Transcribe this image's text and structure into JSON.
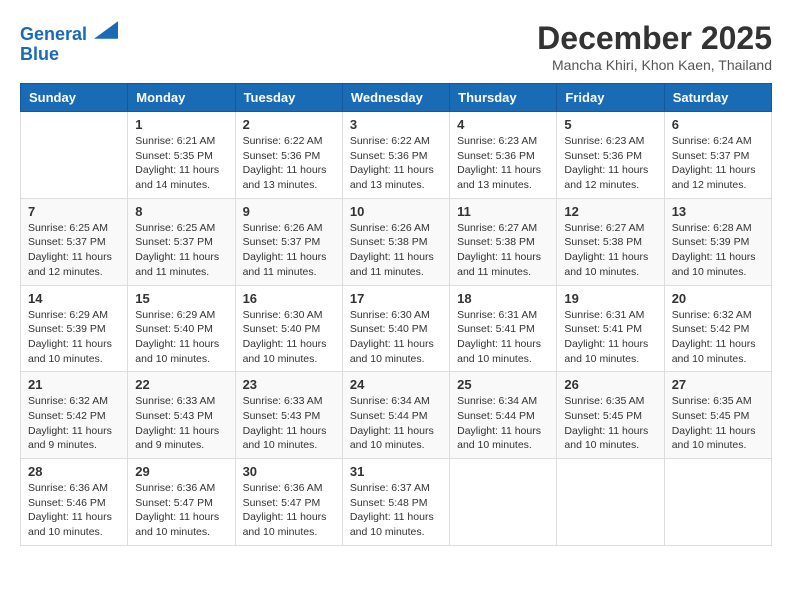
{
  "header": {
    "logo_line1": "General",
    "logo_line2": "Blue",
    "month_title": "December 2025",
    "location": "Mancha Khiri, Khon Kaen, Thailand"
  },
  "days_of_week": [
    "Sunday",
    "Monday",
    "Tuesday",
    "Wednesday",
    "Thursday",
    "Friday",
    "Saturday"
  ],
  "weeks": [
    [
      {
        "day": "",
        "info": ""
      },
      {
        "day": "1",
        "info": "Sunrise: 6:21 AM\nSunset: 5:35 PM\nDaylight: 11 hours\nand 14 minutes."
      },
      {
        "day": "2",
        "info": "Sunrise: 6:22 AM\nSunset: 5:36 PM\nDaylight: 11 hours\nand 13 minutes."
      },
      {
        "day": "3",
        "info": "Sunrise: 6:22 AM\nSunset: 5:36 PM\nDaylight: 11 hours\nand 13 minutes."
      },
      {
        "day": "4",
        "info": "Sunrise: 6:23 AM\nSunset: 5:36 PM\nDaylight: 11 hours\nand 13 minutes."
      },
      {
        "day": "5",
        "info": "Sunrise: 6:23 AM\nSunset: 5:36 PM\nDaylight: 11 hours\nand 12 minutes."
      },
      {
        "day": "6",
        "info": "Sunrise: 6:24 AM\nSunset: 5:37 PM\nDaylight: 11 hours\nand 12 minutes."
      }
    ],
    [
      {
        "day": "7",
        "info": "Sunrise: 6:25 AM\nSunset: 5:37 PM\nDaylight: 11 hours\nand 12 minutes."
      },
      {
        "day": "8",
        "info": "Sunrise: 6:25 AM\nSunset: 5:37 PM\nDaylight: 11 hours\nand 11 minutes."
      },
      {
        "day": "9",
        "info": "Sunrise: 6:26 AM\nSunset: 5:37 PM\nDaylight: 11 hours\nand 11 minutes."
      },
      {
        "day": "10",
        "info": "Sunrise: 6:26 AM\nSunset: 5:38 PM\nDaylight: 11 hours\nand 11 minutes."
      },
      {
        "day": "11",
        "info": "Sunrise: 6:27 AM\nSunset: 5:38 PM\nDaylight: 11 hours\nand 11 minutes."
      },
      {
        "day": "12",
        "info": "Sunrise: 6:27 AM\nSunset: 5:38 PM\nDaylight: 11 hours\nand 10 minutes."
      },
      {
        "day": "13",
        "info": "Sunrise: 6:28 AM\nSunset: 5:39 PM\nDaylight: 11 hours\nand 10 minutes."
      }
    ],
    [
      {
        "day": "14",
        "info": "Sunrise: 6:29 AM\nSunset: 5:39 PM\nDaylight: 11 hours\nand 10 minutes."
      },
      {
        "day": "15",
        "info": "Sunrise: 6:29 AM\nSunset: 5:40 PM\nDaylight: 11 hours\nand 10 minutes."
      },
      {
        "day": "16",
        "info": "Sunrise: 6:30 AM\nSunset: 5:40 PM\nDaylight: 11 hours\nand 10 minutes."
      },
      {
        "day": "17",
        "info": "Sunrise: 6:30 AM\nSunset: 5:40 PM\nDaylight: 11 hours\nand 10 minutes."
      },
      {
        "day": "18",
        "info": "Sunrise: 6:31 AM\nSunset: 5:41 PM\nDaylight: 11 hours\nand 10 minutes."
      },
      {
        "day": "19",
        "info": "Sunrise: 6:31 AM\nSunset: 5:41 PM\nDaylight: 11 hours\nand 10 minutes."
      },
      {
        "day": "20",
        "info": "Sunrise: 6:32 AM\nSunset: 5:42 PM\nDaylight: 11 hours\nand 10 minutes."
      }
    ],
    [
      {
        "day": "21",
        "info": "Sunrise: 6:32 AM\nSunset: 5:42 PM\nDaylight: 11 hours\nand 9 minutes."
      },
      {
        "day": "22",
        "info": "Sunrise: 6:33 AM\nSunset: 5:43 PM\nDaylight: 11 hours\nand 9 minutes."
      },
      {
        "day": "23",
        "info": "Sunrise: 6:33 AM\nSunset: 5:43 PM\nDaylight: 11 hours\nand 10 minutes."
      },
      {
        "day": "24",
        "info": "Sunrise: 6:34 AM\nSunset: 5:44 PM\nDaylight: 11 hours\nand 10 minutes."
      },
      {
        "day": "25",
        "info": "Sunrise: 6:34 AM\nSunset: 5:44 PM\nDaylight: 11 hours\nand 10 minutes."
      },
      {
        "day": "26",
        "info": "Sunrise: 6:35 AM\nSunset: 5:45 PM\nDaylight: 11 hours\nand 10 minutes."
      },
      {
        "day": "27",
        "info": "Sunrise: 6:35 AM\nSunset: 5:45 PM\nDaylight: 11 hours\nand 10 minutes."
      }
    ],
    [
      {
        "day": "28",
        "info": "Sunrise: 6:36 AM\nSunset: 5:46 PM\nDaylight: 11 hours\nand 10 minutes."
      },
      {
        "day": "29",
        "info": "Sunrise: 6:36 AM\nSunset: 5:47 PM\nDaylight: 11 hours\nand 10 minutes."
      },
      {
        "day": "30",
        "info": "Sunrise: 6:36 AM\nSunset: 5:47 PM\nDaylight: 11 hours\nand 10 minutes."
      },
      {
        "day": "31",
        "info": "Sunrise: 6:37 AM\nSunset: 5:48 PM\nDaylight: 11 hours\nand 10 minutes."
      },
      {
        "day": "",
        "info": ""
      },
      {
        "day": "",
        "info": ""
      },
      {
        "day": "",
        "info": ""
      }
    ]
  ]
}
